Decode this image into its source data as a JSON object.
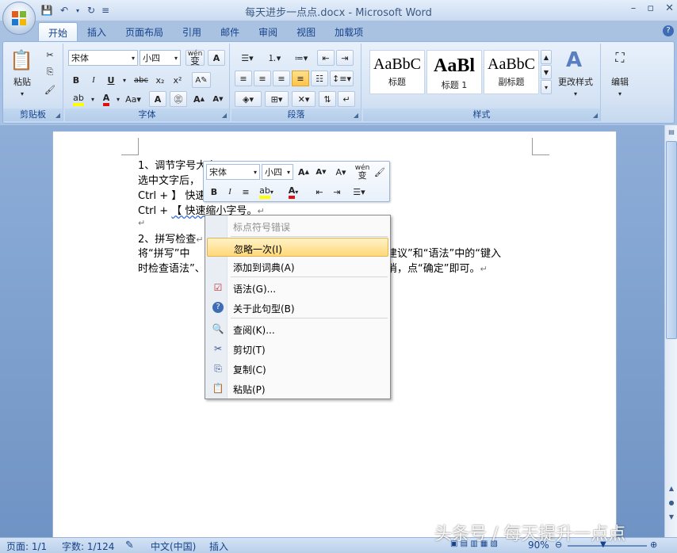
{
  "window": {
    "title": "每天进步一点点.docx - Microsoft Word"
  },
  "tabs": [
    "开始",
    "插入",
    "页面布局",
    "引用",
    "邮件",
    "审阅",
    "视图",
    "加载项"
  ],
  "ribbon": {
    "clipboard": {
      "paste": "粘贴",
      "label": "剪贴板"
    },
    "font": {
      "font_name": "宋体",
      "font_size": "小四",
      "phonetic": "wén",
      "label": "字体"
    },
    "paragraph": {
      "label": "段落"
    },
    "styles": {
      "items": [
        {
          "sample": "AaBbC",
          "name": "标题"
        },
        {
          "sample": "AaBl",
          "name": "标题 1"
        },
        {
          "sample": "AaBbC",
          "name": "副标题"
        }
      ],
      "change_styles": "更改样式",
      "label": "样式"
    },
    "editing": {
      "label": "编辑"
    }
  },
  "document": {
    "lines": [
      "1、调节字号大小",
      "选中文字后，",
      "Ctrl +",
      "】 快速",
      "Ctrl +",
      "【 快速缩小字号。",
      "2、拼写检查",
      "将“拼写”中",
      "建议”和“语法”中的“键入",
      "时检查语法”、",
      "消，点“确定”即可。"
    ]
  },
  "mini_toolbar": {
    "font_name": "宋体",
    "font_size": "小四",
    "phonetic": "wén"
  },
  "context_menu": {
    "header": "标点符号错误",
    "items": [
      {
        "label": "忽略一次(I)",
        "icon": "none"
      },
      {
        "label": "添加到词典(A)",
        "icon": "none"
      },
      {
        "label": "语法(G)...",
        "icon": "grammar-icon"
      },
      {
        "label": "关于此句型(B)",
        "icon": "help-icon"
      },
      {
        "label": "查阅(K)...",
        "icon": "research-icon"
      },
      {
        "label": "剪切(T)",
        "icon": "scissors-icon"
      },
      {
        "label": "复制(C)",
        "icon": "copy-icon"
      },
      {
        "label": "粘贴(P)",
        "icon": "paste-icon"
      }
    ]
  },
  "status": {
    "page": "页面: 1/1",
    "words": "字数: 1/124",
    "language": "中文(中国)",
    "mode": "插入",
    "zoom": "90%"
  },
  "watermark": "头条号 / 每天提升一点点",
  "colors": {
    "highlight": "#ffd878",
    "accent": "#15428b",
    "font_color_red": "#e01010",
    "highlighter_yellow": "#ffff00"
  }
}
